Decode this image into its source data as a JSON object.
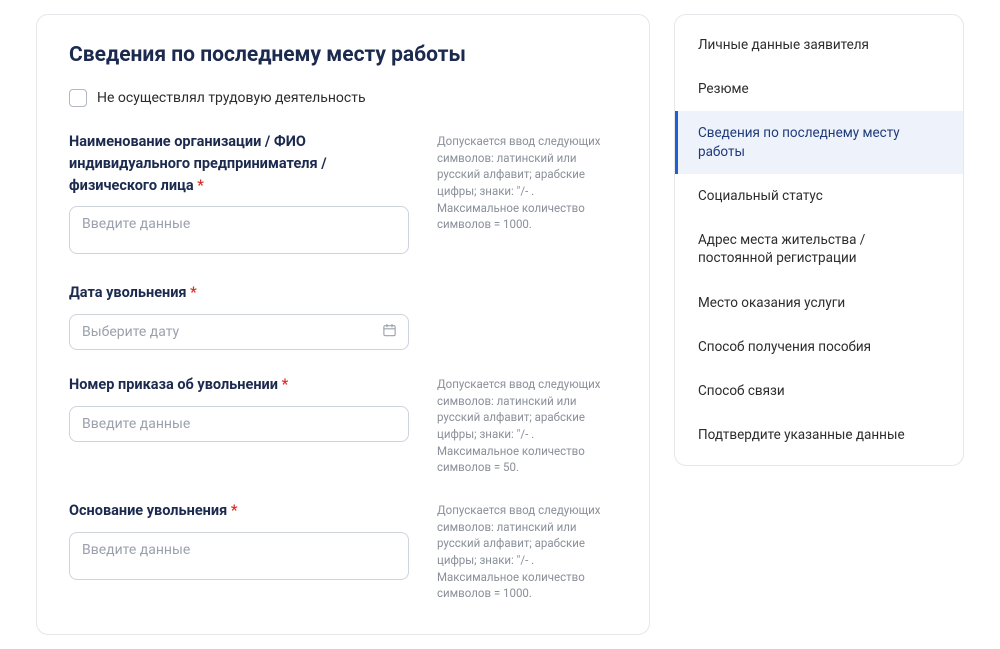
{
  "title": "Сведения по последнему месту работы",
  "checkbox_label": "Не осуществлял трудовую деятельность",
  "fields": {
    "org": {
      "label": "Наименование организации / ФИО индивидуального предпринимателя / физического лица",
      "placeholder": "Введите данные",
      "hint": "Допускается ввод следующих символов: латинский или русский алфавит; арабские цифры; знаки: \"/- . Максимальное количество символов = 1000."
    },
    "date": {
      "label": "Дата увольнения",
      "placeholder": "Выберите дату"
    },
    "order_no": {
      "label": "Номер приказа об увольнении",
      "placeholder": "Введите данные",
      "hint": "Допускается ввод следующих символов: латинский или русский алфавит; арабские цифры; знаки: \"/- . Максимальное количество символов = 50."
    },
    "reason": {
      "label": "Основание увольнения",
      "placeholder": "Введите данные",
      "hint": "Допускается ввод следующих символов: латинский или русский алфавит; арабские цифры; знаки: \"/- . Максимальное количество символов = 1000."
    }
  },
  "required_mark": "*",
  "sidebar": {
    "items": [
      {
        "label": "Личные данные заявителя",
        "active": false
      },
      {
        "label": "Резюме",
        "active": false
      },
      {
        "label": "Сведения по последнему месту работы",
        "active": true
      },
      {
        "label": "Социальный статус",
        "active": false
      },
      {
        "label": "Адрес места жительства / постоянной регистрации",
        "active": false
      },
      {
        "label": "Место оказания услуги",
        "active": false
      },
      {
        "label": "Способ получения пособия",
        "active": false
      },
      {
        "label": "Способ связи",
        "active": false
      },
      {
        "label": "Подтвердите указанные данные",
        "active": false
      }
    ]
  }
}
